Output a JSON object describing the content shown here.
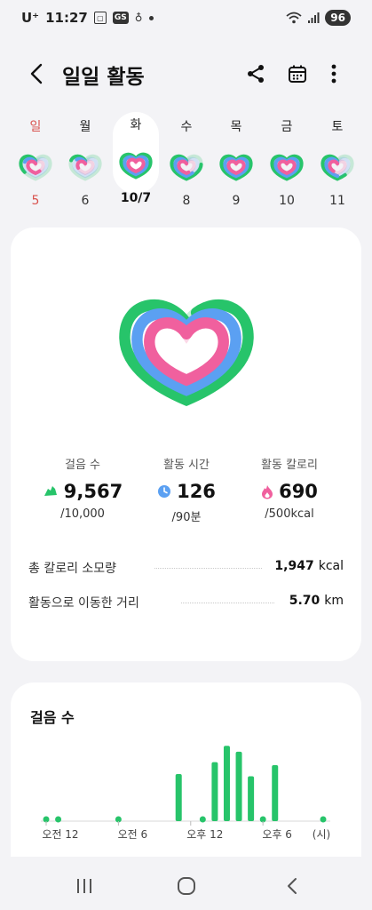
{
  "status_bar": {
    "carrier": "U⁺",
    "time": "11:27",
    "battery": "96",
    "icons": [
      "screenshot-icon",
      "gs-icon",
      "sync-icon",
      "dot-icon",
      "wifi-icon",
      "signal-icon"
    ]
  },
  "header": {
    "title": "일일 활동",
    "icons": [
      "back-icon",
      "share-icon",
      "calendar-icon",
      "more-icon"
    ]
  },
  "week": {
    "selected_index": 2,
    "days": [
      {
        "name": "일",
        "num": "5",
        "sunday": true,
        "rings": [
          0.35,
          0.2,
          0.6
        ]
      },
      {
        "name": "월",
        "num": "6",
        "sunday": false,
        "rings": [
          0.2,
          0.15,
          0.3
        ]
      },
      {
        "name": "화",
        "num": "10/7",
        "sunday": false,
        "rings": [
          0.96,
          1.0,
          1.0
        ]
      },
      {
        "name": "수",
        "num": "8",
        "sunday": false,
        "rings": [
          0.75,
          0.6,
          0.55
        ]
      },
      {
        "name": "목",
        "num": "9",
        "sunday": false,
        "rings": [
          1.0,
          1.0,
          1.0
        ]
      },
      {
        "name": "금",
        "num": "10",
        "sunday": false,
        "rings": [
          1.0,
          1.0,
          1.0
        ]
      },
      {
        "name": "토",
        "num": "11",
        "sunday": false,
        "rings": [
          0.6,
          0.5,
          0.4
        ]
      }
    ]
  },
  "colors": {
    "steps": "#27c46a",
    "time": "#5ba0f2",
    "calories": "#f0609e",
    "sunday": "#d9534f"
  },
  "stats": {
    "steps": {
      "label": "걸음 수",
      "value": "9,567",
      "goal": "/10,000",
      "icon": "shoe-icon"
    },
    "time": {
      "label": "활동 시간",
      "value": "126",
      "goal": "/90분",
      "icon": "clock-icon"
    },
    "calories": {
      "label": "활동 칼로리",
      "value": "690",
      "goal": "/500kcal",
      "icon": "flame-icon"
    }
  },
  "summary": {
    "total_calories": {
      "label": "총 칼로리 소모량",
      "value": "1,947",
      "unit": "kcal"
    },
    "distance": {
      "label": "활동으로 이동한 거리",
      "value": "5.70",
      "unit": "km"
    }
  },
  "chart_data": {
    "type": "bar",
    "title": "걸음 수",
    "x_tick_labels": [
      "오전 12",
      "오전 6",
      "오후 12",
      "오후 6",
      "(시)"
    ],
    "x_unit": "(시)",
    "hours": [
      0,
      1,
      2,
      3,
      4,
      5,
      6,
      7,
      8,
      9,
      10,
      11,
      12,
      13,
      14,
      15,
      16,
      17,
      18,
      19,
      20,
      21,
      22,
      23
    ],
    "values": [
      15,
      15,
      0,
      0,
      0,
      0,
      10,
      0,
      0,
      0,
      0,
      620,
      0,
      15,
      780,
      1000,
      920,
      590,
      20,
      740,
      0,
      0,
      0,
      15
    ],
    "ylim": [
      0,
      1050
    ],
    "grid": false
  },
  "navbar": {
    "icons": [
      "recent-apps-icon",
      "home-icon",
      "back-nav-icon"
    ]
  }
}
